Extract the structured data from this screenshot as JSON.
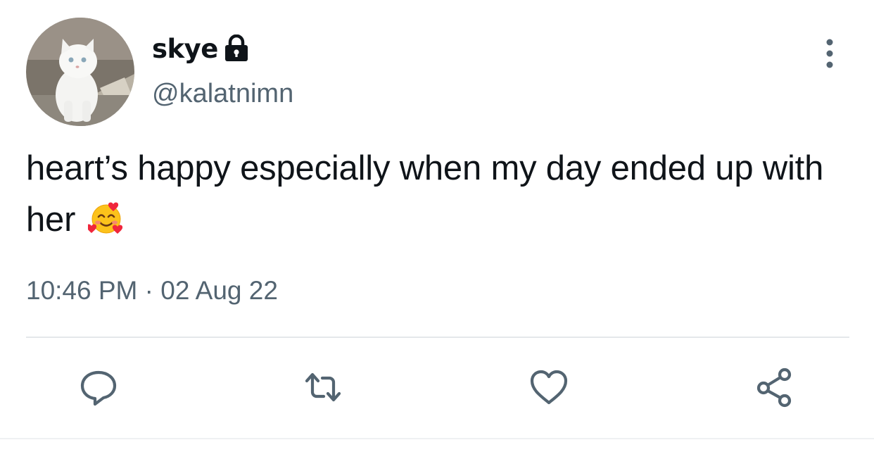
{
  "tweet": {
    "author": {
      "display_name": "skye",
      "handle": "@kalatnimn",
      "avatar_icon": "white-cat-avatar",
      "protected_icon": "lock-icon"
    },
    "text_main": "heart’s happy especially when my day ended up with her",
    "text_emoji_icon": "smiling-face-with-hearts-emoji",
    "timestamp": "10:46 PM · 02 Aug 22"
  },
  "actions": [
    {
      "name": "reply",
      "icon": "reply-icon"
    },
    {
      "name": "retweet",
      "icon": "retweet-icon"
    },
    {
      "name": "like",
      "icon": "heart-icon"
    },
    {
      "name": "share",
      "icon": "share-icon"
    }
  ],
  "colors": {
    "text_primary": "#0f1419",
    "text_secondary": "#536471",
    "icon": "#536471",
    "divider": "#e4e7ea"
  }
}
